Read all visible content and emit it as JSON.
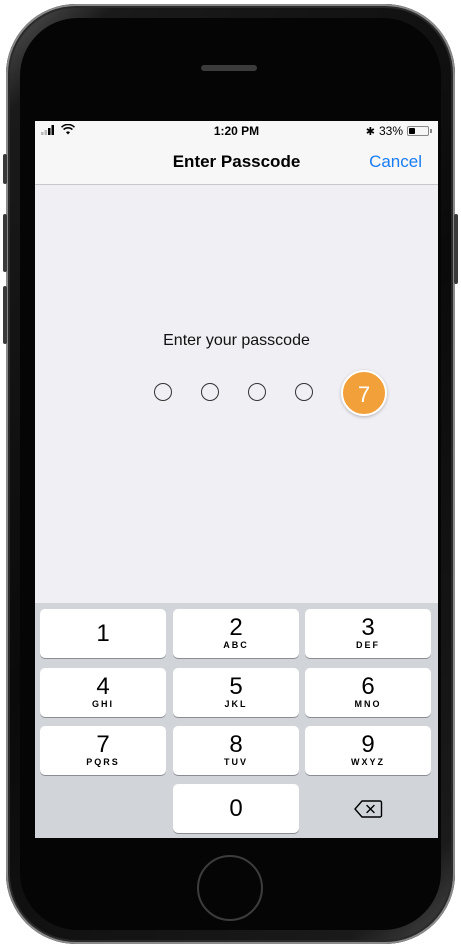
{
  "status_bar": {
    "time": "1:20 PM",
    "battery_percent": "33%",
    "bluetooth_glyph": "✱",
    "battery_level": 0.33
  },
  "nav": {
    "title": "Enter Passcode",
    "cancel_label": "Cancel"
  },
  "passcode": {
    "prompt": "Enter your passcode",
    "dots_total": 4,
    "dots_filled": 0
  },
  "step_badge": "7",
  "keypad": {
    "keys": [
      {
        "digit": "1",
        "letters": ""
      },
      {
        "digit": "2",
        "letters": "ABC"
      },
      {
        "digit": "3",
        "letters": "DEF"
      },
      {
        "digit": "4",
        "letters": "GHI"
      },
      {
        "digit": "5",
        "letters": "JKL"
      },
      {
        "digit": "6",
        "letters": "MNO"
      },
      {
        "digit": "7",
        "letters": "PQRS"
      },
      {
        "digit": "8",
        "letters": "TUV"
      },
      {
        "digit": "9",
        "letters": "WXYZ"
      },
      {
        "digit": "0",
        "letters": ""
      }
    ],
    "delete_icon": "backspace-icon"
  },
  "colors": {
    "accent": "#1a7cf2",
    "badge": "#f2a03a",
    "screen_bg": "#efeff4",
    "keypad_bg": "#d1d4d9"
  }
}
